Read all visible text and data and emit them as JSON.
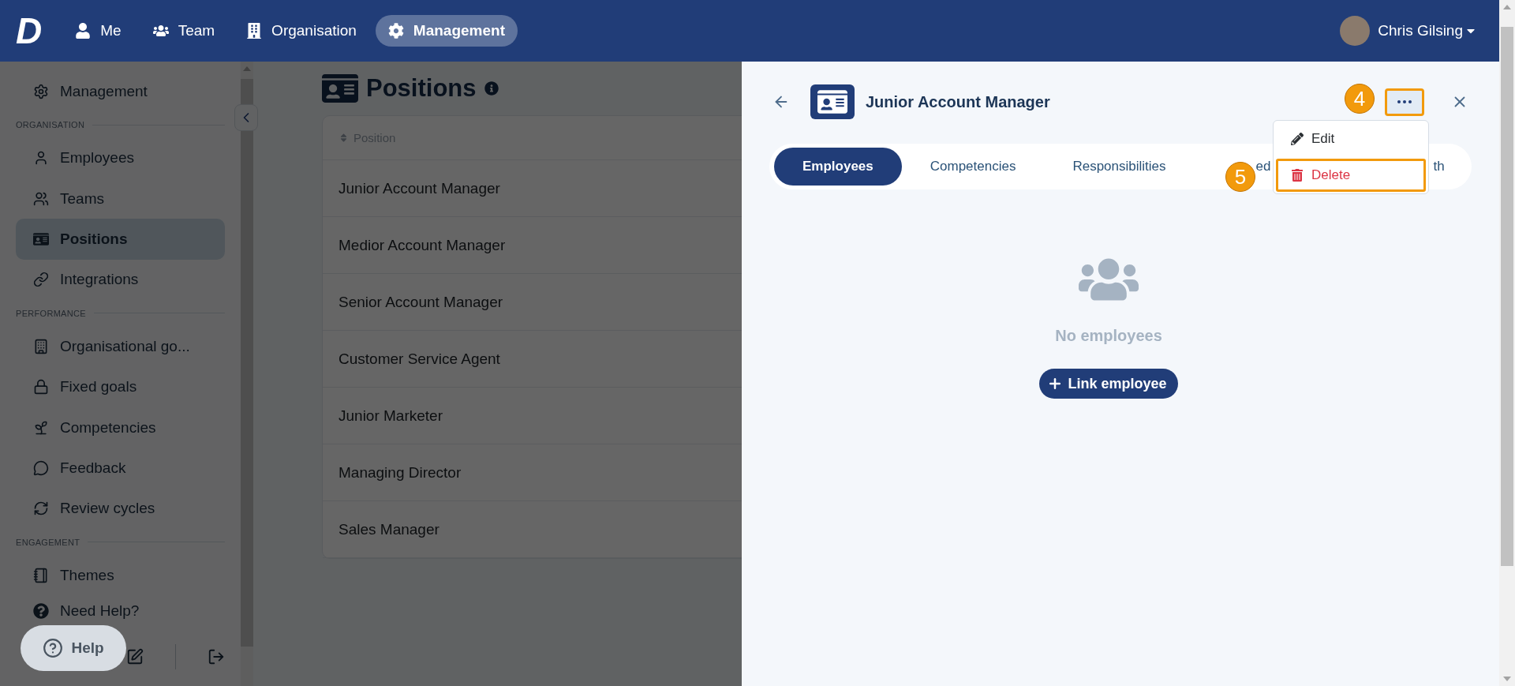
{
  "top_nav": {
    "logo": "D",
    "items": [
      {
        "label": "Me",
        "selected": false
      },
      {
        "label": "Team",
        "selected": false
      },
      {
        "label": "Organisation",
        "selected": false
      },
      {
        "label": "Management",
        "selected": true
      }
    ],
    "user": {
      "name": "Chris Gilsing"
    }
  },
  "sidebar": {
    "items": [
      {
        "kind": "link",
        "label": "Management",
        "selected": false
      },
      {
        "kind": "section",
        "label": "ORGANISATION"
      },
      {
        "kind": "link",
        "label": "Employees",
        "selected": false
      },
      {
        "kind": "link",
        "label": "Teams",
        "selected": false
      },
      {
        "kind": "link",
        "label": "Positions",
        "selected": true
      },
      {
        "kind": "link",
        "label": "Integrations",
        "selected": false
      },
      {
        "kind": "section",
        "label": "PERFORMANCE"
      },
      {
        "kind": "link",
        "label": "Organisational go...",
        "selected": false
      },
      {
        "kind": "link",
        "label": "Fixed goals",
        "selected": false
      },
      {
        "kind": "link",
        "label": "Competencies",
        "selected": false
      },
      {
        "kind": "link",
        "label": "Feedback",
        "selected": false
      },
      {
        "kind": "link",
        "label": "Review cycles",
        "selected": false
      },
      {
        "kind": "section",
        "label": "ENGAGEMENT"
      },
      {
        "kind": "link",
        "label": "Themes",
        "selected": false
      },
      {
        "kind": "help",
        "label": "Need Help?",
        "selected": false
      }
    ],
    "help_button": "Help"
  },
  "page": {
    "title": "Positions",
    "table": {
      "columns": [
        "Position"
      ],
      "rows": [
        "Junior Account Manager",
        "Medior Account Manager",
        "Senior Account Manager",
        "Customer Service Agent",
        "Junior Marketer",
        "Managing Director",
        "Sales Manager"
      ]
    }
  },
  "panel": {
    "title": "Junior Account Manager",
    "more_button": {
      "highlighted": true
    },
    "tabs": [
      {
        "label": "Employees",
        "selected": true
      },
      {
        "label": "Competencies",
        "selected": false
      },
      {
        "label": "Responsibilities",
        "selected": false
      },
      {
        "label": "ed",
        "selected": false
      },
      {
        "label": "th",
        "selected": false
      }
    ],
    "menu": {
      "items": [
        {
          "kind": "edit",
          "label": "Edit",
          "highlighted": false
        },
        {
          "kind": "delete",
          "label": "Delete",
          "highlighted": true
        }
      ]
    },
    "empty_state": {
      "text": "No employees",
      "action": "Link employee"
    },
    "step_markers": [
      "4",
      "5"
    ]
  }
}
